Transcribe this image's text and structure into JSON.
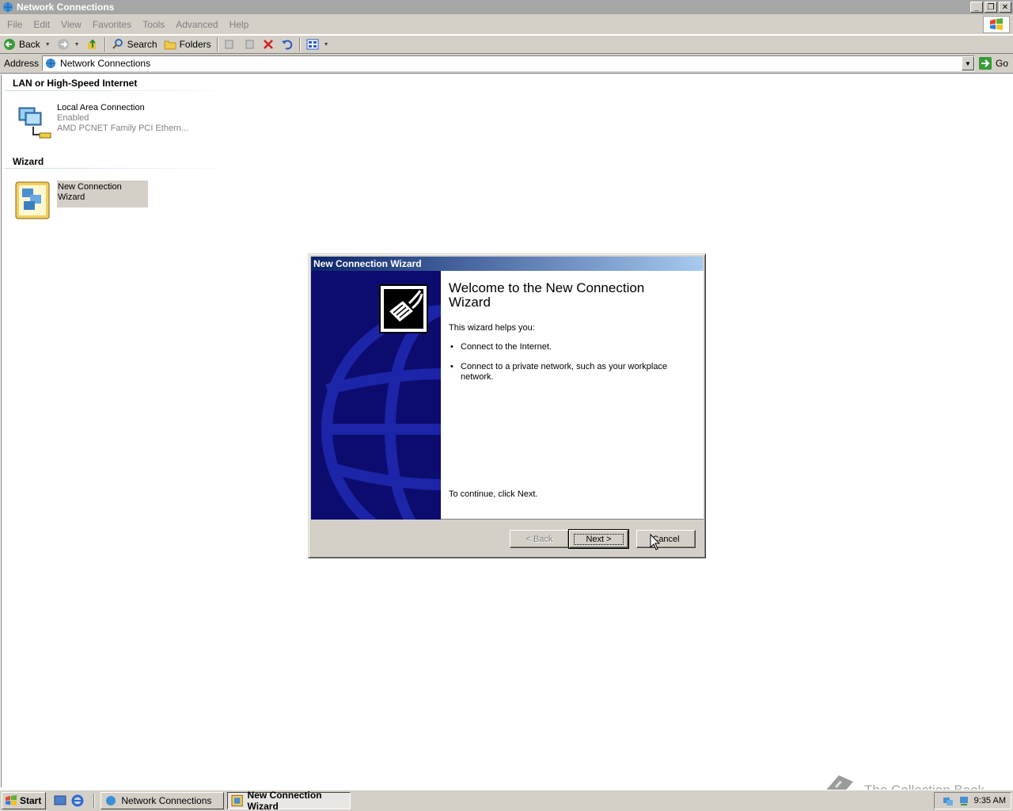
{
  "window": {
    "title": "Network Connections"
  },
  "menu": [
    "File",
    "Edit",
    "View",
    "Favorites",
    "Tools",
    "Advanced",
    "Help"
  ],
  "toolbar": {
    "back": "Back",
    "search": "Search",
    "folders": "Folders"
  },
  "address": {
    "label": "Address",
    "value": "Network Connections",
    "go": "Go"
  },
  "groups": {
    "lan": {
      "header": "LAN or High-Speed Internet",
      "item": {
        "name": "Local Area Connection",
        "status": "Enabled",
        "device": "AMD PCNET Family PCI Ethern..."
      }
    },
    "wizard": {
      "header": "Wizard",
      "item": {
        "name": "New Connection Wizard"
      }
    }
  },
  "dialog": {
    "title": "New Connection Wizard",
    "heading": "Welcome to the New Connection Wizard",
    "intro": "This wizard helps you:",
    "bullets": [
      "Connect to the Internet.",
      "Connect to a private network, such as your workplace network."
    ],
    "continue": "To continue, click Next.",
    "buttons": {
      "back": "< Back",
      "next": "Next >",
      "cancel": "Cancel"
    }
  },
  "taskbar": {
    "start": "Start",
    "tasks": [
      "Network Connections",
      "New Connection Wizard"
    ],
    "clock": "9:35 AM"
  },
  "watermark": "The Collection Book"
}
